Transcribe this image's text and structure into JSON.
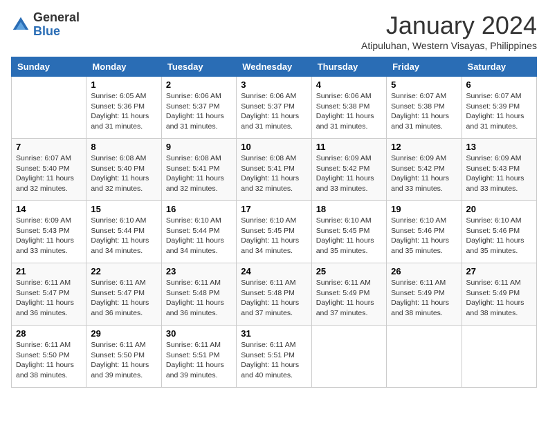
{
  "logo": {
    "general": "General",
    "blue": "Blue"
  },
  "title": "January 2024",
  "subtitle": "Atipuluhan, Western Visayas, Philippines",
  "weekdays": [
    "Sunday",
    "Monday",
    "Tuesday",
    "Wednesday",
    "Thursday",
    "Friday",
    "Saturday"
  ],
  "weeks": [
    [
      {
        "num": "",
        "sunrise": "",
        "sunset": "",
        "daylight": ""
      },
      {
        "num": "1",
        "sunrise": "Sunrise: 6:05 AM",
        "sunset": "Sunset: 5:36 PM",
        "daylight": "Daylight: 11 hours and 31 minutes."
      },
      {
        "num": "2",
        "sunrise": "Sunrise: 6:06 AM",
        "sunset": "Sunset: 5:37 PM",
        "daylight": "Daylight: 11 hours and 31 minutes."
      },
      {
        "num": "3",
        "sunrise": "Sunrise: 6:06 AM",
        "sunset": "Sunset: 5:37 PM",
        "daylight": "Daylight: 11 hours and 31 minutes."
      },
      {
        "num": "4",
        "sunrise": "Sunrise: 6:06 AM",
        "sunset": "Sunset: 5:38 PM",
        "daylight": "Daylight: 11 hours and 31 minutes."
      },
      {
        "num": "5",
        "sunrise": "Sunrise: 6:07 AM",
        "sunset": "Sunset: 5:38 PM",
        "daylight": "Daylight: 11 hours and 31 minutes."
      },
      {
        "num": "6",
        "sunrise": "Sunrise: 6:07 AM",
        "sunset": "Sunset: 5:39 PM",
        "daylight": "Daylight: 11 hours and 31 minutes."
      }
    ],
    [
      {
        "num": "7",
        "sunrise": "Sunrise: 6:07 AM",
        "sunset": "Sunset: 5:40 PM",
        "daylight": "Daylight: 11 hours and 32 minutes."
      },
      {
        "num": "8",
        "sunrise": "Sunrise: 6:08 AM",
        "sunset": "Sunset: 5:40 PM",
        "daylight": "Daylight: 11 hours and 32 minutes."
      },
      {
        "num": "9",
        "sunrise": "Sunrise: 6:08 AM",
        "sunset": "Sunset: 5:41 PM",
        "daylight": "Daylight: 11 hours and 32 minutes."
      },
      {
        "num": "10",
        "sunrise": "Sunrise: 6:08 AM",
        "sunset": "Sunset: 5:41 PM",
        "daylight": "Daylight: 11 hours and 32 minutes."
      },
      {
        "num": "11",
        "sunrise": "Sunrise: 6:09 AM",
        "sunset": "Sunset: 5:42 PM",
        "daylight": "Daylight: 11 hours and 33 minutes."
      },
      {
        "num": "12",
        "sunrise": "Sunrise: 6:09 AM",
        "sunset": "Sunset: 5:42 PM",
        "daylight": "Daylight: 11 hours and 33 minutes."
      },
      {
        "num": "13",
        "sunrise": "Sunrise: 6:09 AM",
        "sunset": "Sunset: 5:43 PM",
        "daylight": "Daylight: 11 hours and 33 minutes."
      }
    ],
    [
      {
        "num": "14",
        "sunrise": "Sunrise: 6:09 AM",
        "sunset": "Sunset: 5:43 PM",
        "daylight": "Daylight: 11 hours and 33 minutes."
      },
      {
        "num": "15",
        "sunrise": "Sunrise: 6:10 AM",
        "sunset": "Sunset: 5:44 PM",
        "daylight": "Daylight: 11 hours and 34 minutes."
      },
      {
        "num": "16",
        "sunrise": "Sunrise: 6:10 AM",
        "sunset": "Sunset: 5:44 PM",
        "daylight": "Daylight: 11 hours and 34 minutes."
      },
      {
        "num": "17",
        "sunrise": "Sunrise: 6:10 AM",
        "sunset": "Sunset: 5:45 PM",
        "daylight": "Daylight: 11 hours and 34 minutes."
      },
      {
        "num": "18",
        "sunrise": "Sunrise: 6:10 AM",
        "sunset": "Sunset: 5:45 PM",
        "daylight": "Daylight: 11 hours and 35 minutes."
      },
      {
        "num": "19",
        "sunrise": "Sunrise: 6:10 AM",
        "sunset": "Sunset: 5:46 PM",
        "daylight": "Daylight: 11 hours and 35 minutes."
      },
      {
        "num": "20",
        "sunrise": "Sunrise: 6:10 AM",
        "sunset": "Sunset: 5:46 PM",
        "daylight": "Daylight: 11 hours and 35 minutes."
      }
    ],
    [
      {
        "num": "21",
        "sunrise": "Sunrise: 6:11 AM",
        "sunset": "Sunset: 5:47 PM",
        "daylight": "Daylight: 11 hours and 36 minutes."
      },
      {
        "num": "22",
        "sunrise": "Sunrise: 6:11 AM",
        "sunset": "Sunset: 5:47 PM",
        "daylight": "Daylight: 11 hours and 36 minutes."
      },
      {
        "num": "23",
        "sunrise": "Sunrise: 6:11 AM",
        "sunset": "Sunset: 5:48 PM",
        "daylight": "Daylight: 11 hours and 36 minutes."
      },
      {
        "num": "24",
        "sunrise": "Sunrise: 6:11 AM",
        "sunset": "Sunset: 5:48 PM",
        "daylight": "Daylight: 11 hours and 37 minutes."
      },
      {
        "num": "25",
        "sunrise": "Sunrise: 6:11 AM",
        "sunset": "Sunset: 5:49 PM",
        "daylight": "Daylight: 11 hours and 37 minutes."
      },
      {
        "num": "26",
        "sunrise": "Sunrise: 6:11 AM",
        "sunset": "Sunset: 5:49 PM",
        "daylight": "Daylight: 11 hours and 38 minutes."
      },
      {
        "num": "27",
        "sunrise": "Sunrise: 6:11 AM",
        "sunset": "Sunset: 5:49 PM",
        "daylight": "Daylight: 11 hours and 38 minutes."
      }
    ],
    [
      {
        "num": "28",
        "sunrise": "Sunrise: 6:11 AM",
        "sunset": "Sunset: 5:50 PM",
        "daylight": "Daylight: 11 hours and 38 minutes."
      },
      {
        "num": "29",
        "sunrise": "Sunrise: 6:11 AM",
        "sunset": "Sunset: 5:50 PM",
        "daylight": "Daylight: 11 hours and 39 minutes."
      },
      {
        "num": "30",
        "sunrise": "Sunrise: 6:11 AM",
        "sunset": "Sunset: 5:51 PM",
        "daylight": "Daylight: 11 hours and 39 minutes."
      },
      {
        "num": "31",
        "sunrise": "Sunrise: 6:11 AM",
        "sunset": "Sunset: 5:51 PM",
        "daylight": "Daylight: 11 hours and 40 minutes."
      },
      {
        "num": "",
        "sunrise": "",
        "sunset": "",
        "daylight": ""
      },
      {
        "num": "",
        "sunrise": "",
        "sunset": "",
        "daylight": ""
      },
      {
        "num": "",
        "sunrise": "",
        "sunset": "",
        "daylight": ""
      }
    ]
  ]
}
